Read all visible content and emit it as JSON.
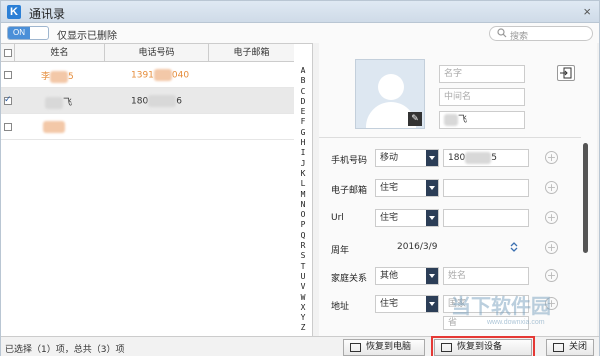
{
  "window": {
    "title": "通讯录",
    "app_icon_letter": "K",
    "close": "×"
  },
  "toolbar": {
    "toggle_state": "ON",
    "toggle_label": "仅显示已删除",
    "search_placeholder": "搜索"
  },
  "table": {
    "columns": [
      "姓名",
      "电话号码",
      "电子邮箱"
    ],
    "rows": [
      {
        "name_prefix": "李",
        "name_suffix": "5",
        "phone_prefix": "1391",
        "phone_suffix": "040",
        "checked": false,
        "selected": false
      },
      {
        "name_prefix": "",
        "name_suffix": "飞",
        "phone_prefix": "180",
        "phone_suffix": "6",
        "checked": true,
        "selected": true
      },
      {
        "name_prefix": "",
        "name_suffix": "",
        "phone_prefix": "",
        "phone_suffix": "",
        "checked": false,
        "selected": false
      }
    ],
    "alphabet": [
      "A",
      "B",
      "C",
      "D",
      "E",
      "F",
      "G",
      "H",
      "I",
      "J",
      "K",
      "L",
      "M",
      "N",
      "O",
      "P",
      "Q",
      "R",
      "S",
      "T",
      "U",
      "V",
      "W",
      "X",
      "Y",
      "Z"
    ]
  },
  "detail": {
    "first_name_placeholder": "名字",
    "middle_name_placeholder": "中间名",
    "last_name_value": "飞",
    "mobile_label": "手机号码",
    "mobile_carrier": "移动",
    "mobile_value": "180",
    "mobile_suffix": "5",
    "email_label": "电子邮箱",
    "email_type": "住宅",
    "url_label": "Url",
    "url_type": "住宅",
    "anniversary_label": "周年",
    "anniversary_value": "2016/3/9",
    "relation_label": "家庭关系",
    "relation_type": "其他",
    "relation_placeholder": "姓名",
    "address_label": "地址",
    "address_type": "住宅",
    "address_placeholder_1": "国家",
    "address_placeholder_2": "省"
  },
  "status": {
    "text": "已选择（1）项，总共（3）项",
    "restore_pc": "恢复到电脑",
    "restore_device": "恢复到设备",
    "close": "关闭"
  },
  "watermark": {
    "text": "当下软件园",
    "url": "www.downxia.com"
  }
}
